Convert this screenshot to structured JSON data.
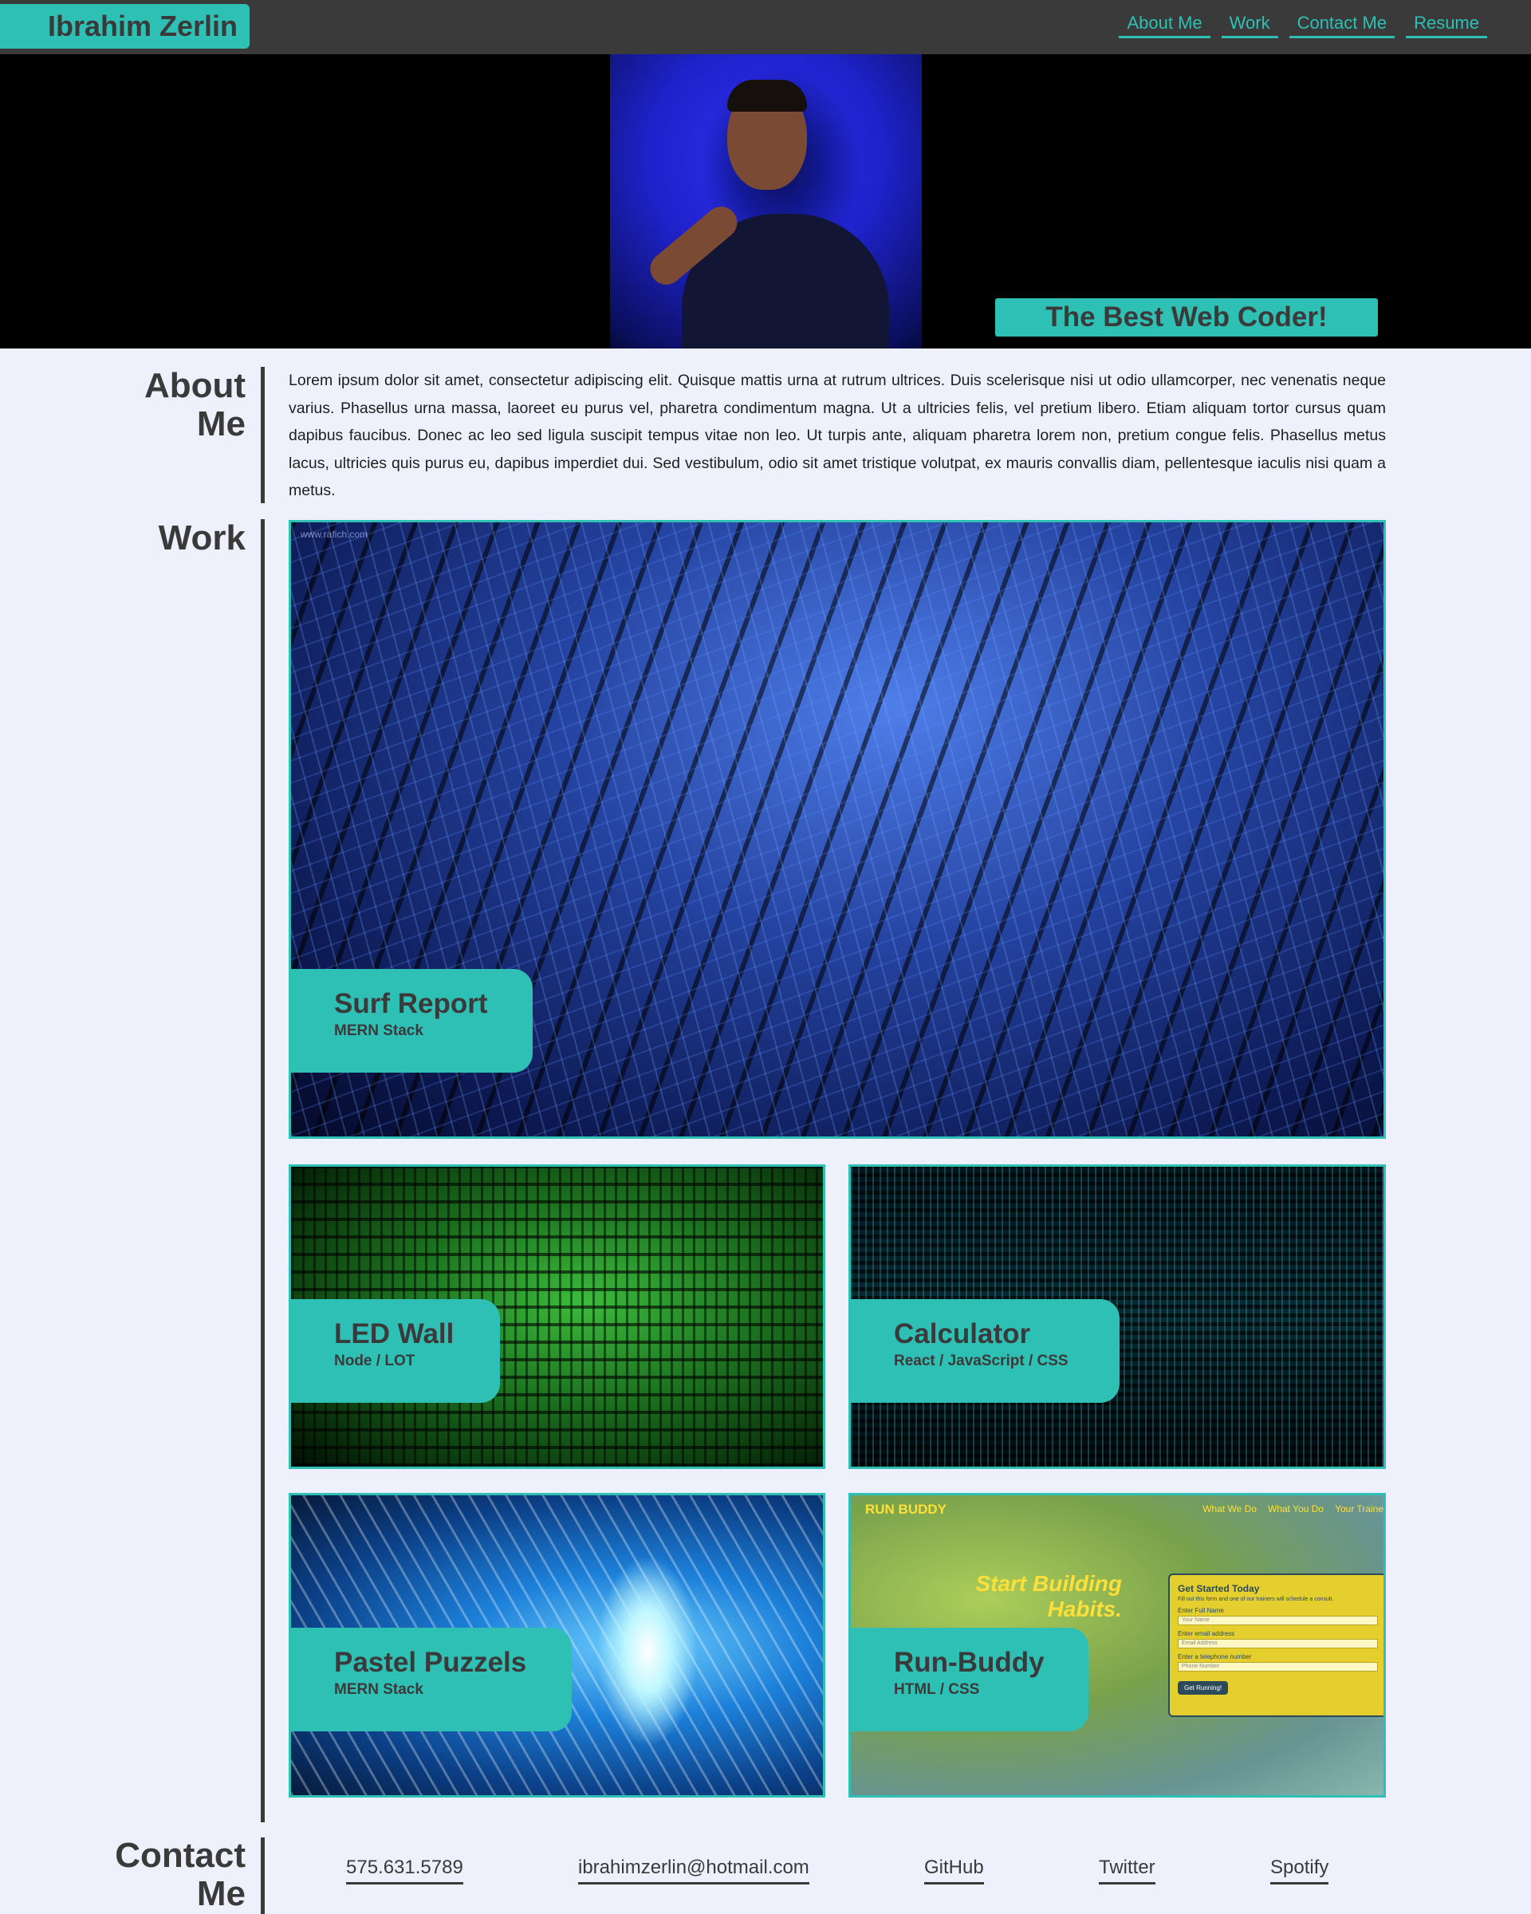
{
  "header": {
    "brand": "Ibrahim Zerlin",
    "nav": [
      "About Me",
      "Work",
      "Contact Me",
      "Resume"
    ]
  },
  "hero": {
    "tagline": "The Best Web Coder!"
  },
  "about": {
    "title": "About Me",
    "text": "Lorem ipsum dolor sit amet, consectetur adipiscing elit. Quisque mattis urna at rutrum ultrices. Duis scelerisque nisi ut odio ullamcorper, nec venenatis neque varius. Phasellus urna massa, laoreet eu purus vel, pharetra condimentum magna. Ut a ultricies felis, vel pretium libero. Etiam aliquam tortor cursus quam dapibus faucibus. Donec ac leo sed ligula suscipit tempus vitae non leo. Ut turpis ante, aliquam pharetra lorem non, pretium congue felis. Phasellus metus lacus, ultricies quis purus eu, dapibus imperdiet dui. Sed vestibulum, odio sit amet tristique volutpat, ex mauris convallis diam, pellentesque iaculis nisi quam a metus."
  },
  "work": {
    "title": "Work",
    "projects": [
      {
        "title": "Surf Report",
        "stack": "MERN Stack"
      },
      {
        "title": "LED Wall",
        "stack": "Node / LOT"
      },
      {
        "title": "Calculator",
        "stack": "React / JavaScript / CSS"
      },
      {
        "title": "Pastel Puzzels",
        "stack": "MERN Stack"
      },
      {
        "title": "Run-Buddy",
        "stack": "HTML / CSS"
      }
    ],
    "run_buddy_preview": {
      "logo": "RUN BUDDY",
      "nav": [
        "What We Do",
        "What You Do",
        "Your Traine"
      ],
      "headline": "Start Building Habits.",
      "form_title": "Get Started Today",
      "form_sub": "Fill out this form and one of our trainers will schedule a consult.",
      "fields": [
        {
          "label": "Enter Full Name",
          "placeholder": "Your Name"
        },
        {
          "label": "Enter email address",
          "placeholder": "Email Address"
        },
        {
          "label": "Enter a telephone number",
          "placeholder": "Phone Number"
        }
      ],
      "button": "Get Running!"
    },
    "watermark": "www.rafich.com"
  },
  "contact": {
    "title": "Contact Me",
    "links": [
      "575.631.5789",
      "ibrahimzerlin@hotmail.com",
      "GitHub",
      "Twitter",
      "Spotify"
    ]
  },
  "colors": {
    "accent": "#2fc0b5",
    "header_bg": "#3a3a3a",
    "page_bg": "#eef0fc",
    "text": "#3a3a3a"
  }
}
